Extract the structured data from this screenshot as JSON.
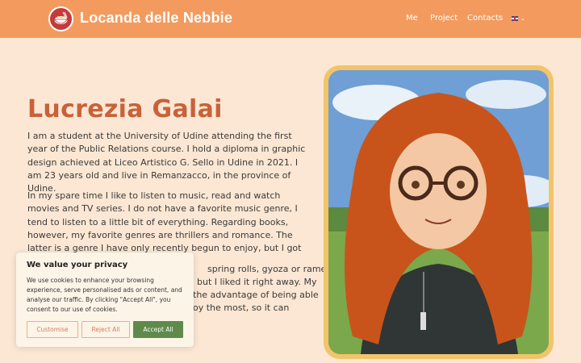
{
  "header": {
    "brand": "Locanda delle Nebbie",
    "nav": {
      "me": "Me",
      "project": "Project",
      "contacts": "Contacts"
    },
    "language_icon": "uk-flag-icon",
    "bg_color": "#f39b5e"
  },
  "main": {
    "title": "Lucrezia Galai",
    "paragraphs": [
      "I am a student at the University of Udine attending the first year of the Public Relations course. I hold a diploma in graphic design achieved at Liceo Artistico G. Sello in Udine in 2021. I am 23 years old and live in Remanzacco, in the province of Udine.",
      "In my spare time I like to listen to music, read and watch movies and TV series. I do not have a favorite music genre, I tend to listen to a little bit of everything. Regarding books, however, my favorite genres are thrillers and romance. The latter is a genre I have only recently begun to enjoy, but I got hooked on it right away.",
      "spring rolls, gyoza or ramen. but I liked it right away. My the advantage of being able oy the most, so it can"
    ],
    "title_color": "#c8623a"
  },
  "cookie_banner": {
    "title": "We value your privacy",
    "text": "We use cookies to enhance your browsing experience, serve personalised ads or content, and analyse our traffic. By clicking \"Accept All\", you consent to our use of cookies.",
    "customise": "Customise",
    "reject": "Reject All",
    "accept": "Accept All",
    "accept_color": "#5f8a4c"
  }
}
